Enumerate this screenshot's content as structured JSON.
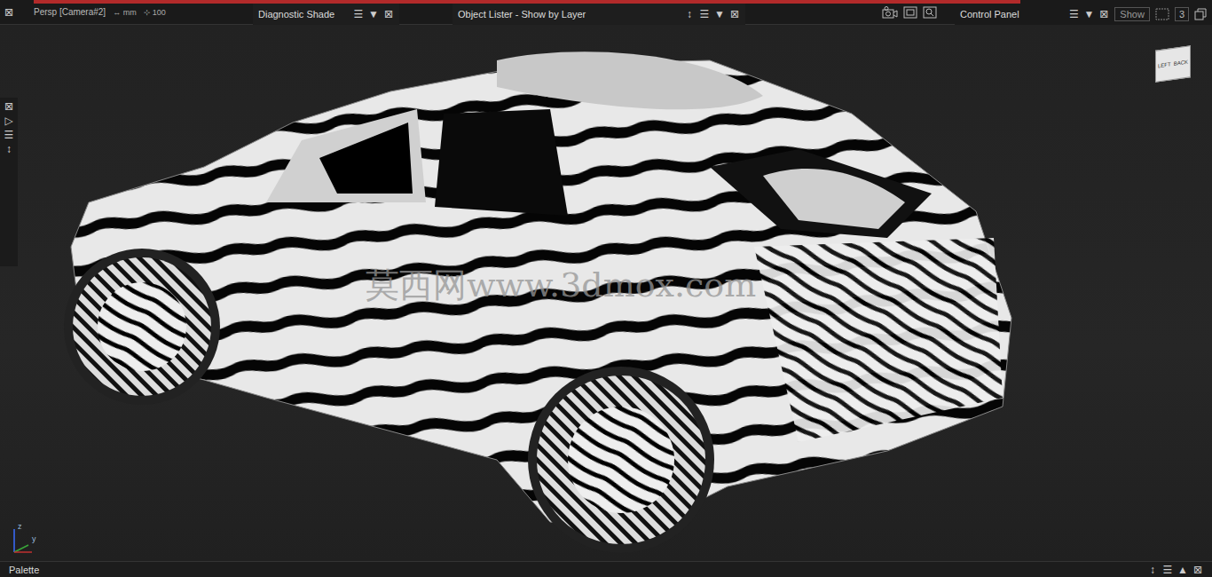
{
  "viewport": {
    "camera": "Persp [Camera#2]",
    "units_icon": "↔",
    "units": "mm",
    "grid_icon": "⊹",
    "grid": "100",
    "watermark": "莫西网www.3dmox.com",
    "view_cube": [
      "LEFT",
      "BACK"
    ],
    "axes": [
      "z",
      "y"
    ]
  },
  "close_icon": "⊠",
  "panels": [
    {
      "title": "Diagnostic Shade",
      "buttons": [
        "☰",
        "▼",
        "⊠"
      ]
    },
    {
      "title": "Object Lister - Show by Layer",
      "buttons": [
        "↕",
        "☰",
        "▼",
        "⊠"
      ]
    }
  ],
  "control_panel": {
    "title": "Control Panel",
    "buttons": [
      "☰",
      "▼",
      "⊠"
    ],
    "show": "Show",
    "count": "3"
  },
  "side_toolbar": [
    "⊠",
    "▷",
    "☰",
    "↕"
  ],
  "palette": {
    "title": "Palette",
    "buttons": [
      "↕",
      "☰",
      "▲",
      "⊠"
    ]
  }
}
